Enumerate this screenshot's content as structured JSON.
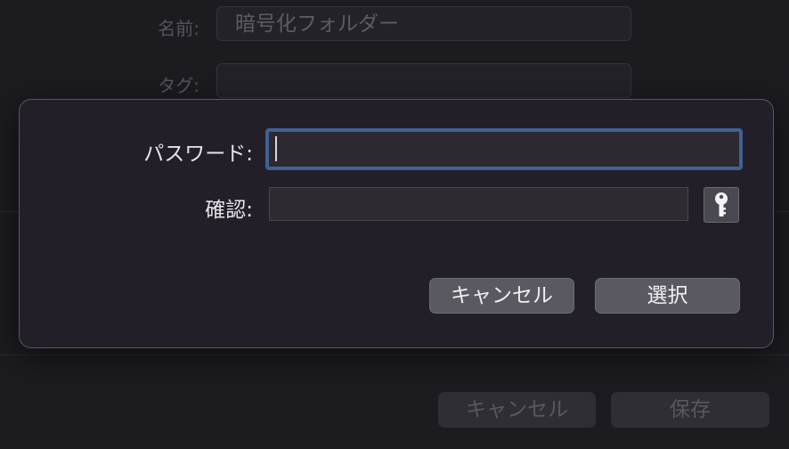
{
  "background_sheet": {
    "name_label": "名前:",
    "name_value": "暗号化フォルダー",
    "tags_label": "タグ:",
    "tags_value": "",
    "cancel_label": "キャンセル",
    "save_label": "保存"
  },
  "password_dialog": {
    "password_label": "パスワード:",
    "password_value": "",
    "verify_label": "確認:",
    "verify_value": "",
    "key_icon": "key-icon",
    "cancel_label": "キャンセル",
    "choose_label": "選択"
  },
  "colors": {
    "window_bg": "#1c1b20",
    "dialog_bg": "#231f29",
    "focus_ring": "#3e6296",
    "button_bg": "#5a5860"
  }
}
